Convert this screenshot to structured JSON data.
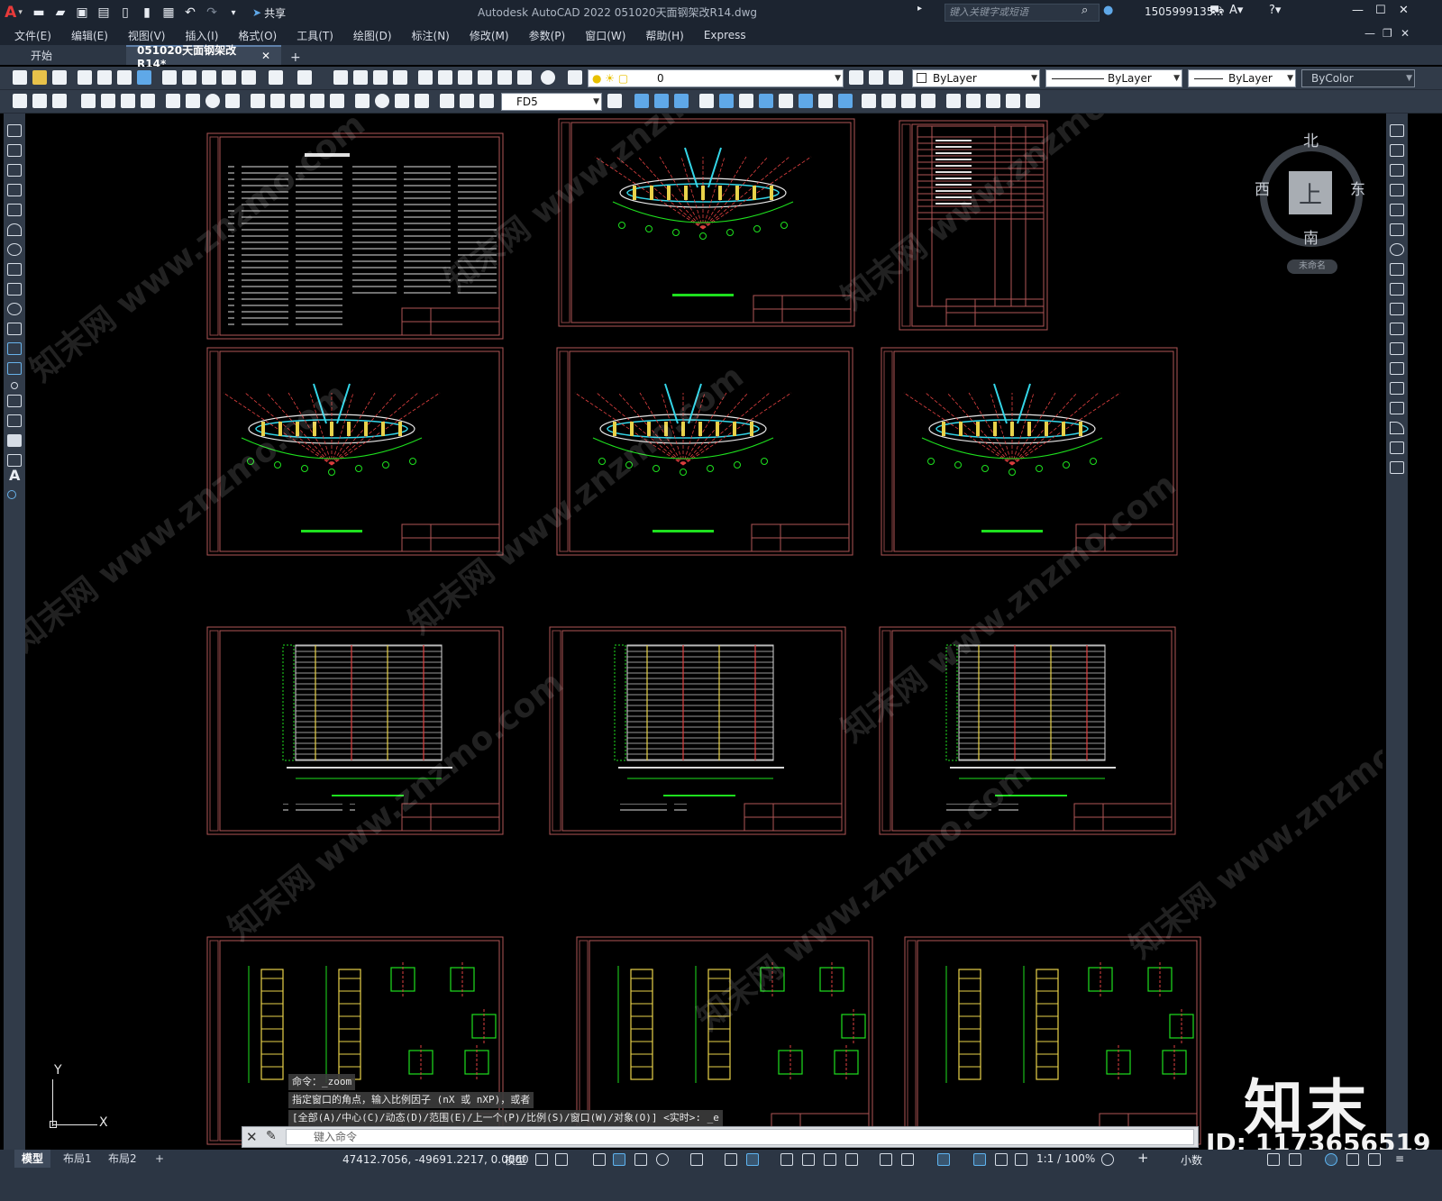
{
  "titlebar": {
    "app_logo": "A",
    "share_label": "共享",
    "title": "Autodesk AutoCAD 2022    051020天面钢架改R14.dwg",
    "search_placeholder": "键入关键字或短语",
    "user": "1505999135..."
  },
  "menu": [
    "文件(E)",
    "编辑(E)",
    "视图(V)",
    "插入(I)",
    "格式(O)",
    "工具(T)",
    "绘图(D)",
    "标注(N)",
    "修改(M)",
    "参数(P)",
    "窗口(W)",
    "帮助(H)",
    "Express"
  ],
  "doc_tabs": [
    {
      "label": "开始",
      "active": false
    },
    {
      "label": "051020天面钢架改R14*",
      "active": true
    }
  ],
  "toolbar": {
    "layer_value": "0",
    "color_value": "ByLayer",
    "linetype_value": "ByLayer",
    "lineweight_value": "ByLayer",
    "plotstyle_value": "ByColor",
    "dimstyle_value": "FD5"
  },
  "viewcube": {
    "face": "上",
    "north": "北",
    "south": "南",
    "west": "西",
    "east": "东",
    "ucs_name": "未命名"
  },
  "ucs": {
    "x_label": "X",
    "y_label": "Y"
  },
  "command": {
    "history": [
      "命令：_zoom",
      "指定窗口的角点，输入比例因子 (nX 或 nXP)，或者",
      "[全部(A)/中心(C)/动态(D)/范围(E)/上一个(P)/比例(S)/窗口(W)/对象(O)] <实时>: _e"
    ],
    "input_placeholder": "键入命令"
  },
  "layout_tabs": [
    {
      "label": "模型",
      "active": true
    },
    {
      "label": "布局1",
      "active": false
    },
    {
      "label": "布局2",
      "active": false
    }
  ],
  "status": {
    "coords": "47412.7056, -49691.2217, 0.0000",
    "model_label": "模型",
    "scale": "1:1 / 100%",
    "units": "小数"
  },
  "watermark": {
    "logo_text": "知末",
    "id_text": "ID: 1173656519",
    "diagonal_text": "知末网 www.znzmo.com"
  },
  "colors": {
    "titlebar_bg": "#1c2430",
    "toolbar_bg": "#313b49",
    "canvas_bg": "#000000",
    "sheet_frame": "#b05656",
    "drawing_green": "#1ee01e",
    "drawing_cyan": "#34d6e8",
    "drawing_yellow": "#e8d24a",
    "drawing_red": "#e04040"
  }
}
